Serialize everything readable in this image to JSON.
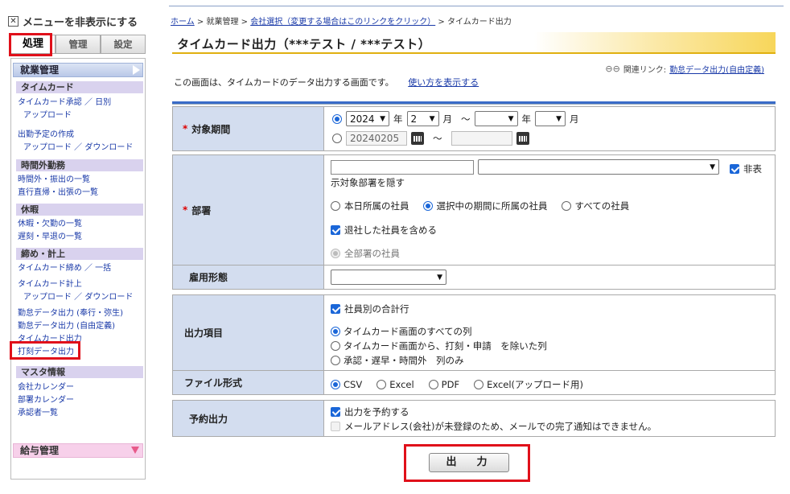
{
  "sidebar": {
    "toggle_label": "メニューを非表示にする",
    "tabs": [
      "処理",
      "管理",
      "設定"
    ],
    "section_header": "就業管理",
    "categories": [
      {
        "title": "タイムカード",
        "items": [
          {
            "label": "タイムカード承認 ／ 日別"
          },
          {
            "label": "アップロード"
          },
          {
            "label": "出勤予定の作成"
          },
          {
            "label": "アップロード ／ ダウンロード"
          }
        ]
      },
      {
        "title": "時間外勤務",
        "items": [
          {
            "label": "時間外・振出の一覧"
          },
          {
            "label": "直行直帰・出張の一覧"
          }
        ]
      },
      {
        "title": "休暇",
        "items": [
          {
            "label": "休暇・欠勤の一覧"
          },
          {
            "label": "遅刻・早退の一覧"
          }
        ]
      },
      {
        "title": "締め・計上",
        "items": [
          {
            "label": "タイムカード締め ／ 一括"
          },
          {
            "label": "タイムカード計上"
          },
          {
            "label": "アップロード ／ ダウンロード"
          },
          {
            "label": "勤怠データ出力 (奉行・弥生)"
          },
          {
            "label": "勤怠データ出力 (自由定義)"
          },
          {
            "label": "タイムカード出力"
          },
          {
            "label": "打刻データ出力"
          }
        ]
      },
      {
        "title": "マスタ情報",
        "items": [
          {
            "label": "会社カレンダー"
          },
          {
            "label": "部署カレンダー"
          },
          {
            "label": "承認者一覧"
          }
        ]
      }
    ],
    "footer_label": "給与管理"
  },
  "breadcrumb": {
    "home": "ホーム",
    "sep": ">",
    "item1": "就業管理",
    "item2": "会社選択（変更する場合はこのリンクをクリック）",
    "current": "タイムカード出力"
  },
  "page": {
    "title": "タイムカード出力（***テスト / ***テスト）",
    "related_label": "関連リンク:",
    "related_link": "勤怠データ出力(自由定義)",
    "description": "この画面は、タイムカードのデータ出力する画面です。",
    "howto_link": "使い方を表示する"
  },
  "form": {
    "period": {
      "label": "対象期間",
      "year_value": "2024",
      "year_suffix": "年",
      "month_value": "2",
      "month_suffix": "月",
      "tilde": "～",
      "end_year_suffix": "年",
      "end_month_suffix": "月",
      "date_from": "20240205",
      "date_tilde": "～"
    },
    "department": {
      "label": "部署",
      "hide_label": "非表",
      "hide_label_cont": "示対象部署を隠す",
      "scope_options": [
        "本日所属の社員",
        "選択中の期間に所属の社員",
        "すべての社員"
      ],
      "include_retired": "退社した社員を含める",
      "all_depts": "全部署の社員"
    },
    "employment": {
      "label": "雇用形態"
    },
    "output_items": {
      "label": "出力項目",
      "subtotal": "社員別の合計行",
      "options": [
        "タイムカード画面のすべての列",
        "タイムカード画面から、打刻・申請　を除いた列",
        "承認・遅早・時間外　列のみ"
      ]
    },
    "file_format": {
      "label": "ファイル形式",
      "options": [
        "CSV",
        "Excel",
        "PDF",
        "Excel(アップロード用)"
      ]
    },
    "reserve": {
      "label": "予約出力",
      "reserve_check": "出力を予約する",
      "mail_note": "メールアドレス(会社)が未登録のため、メールでの完了通知はできません。"
    },
    "submit_label": "出　力"
  },
  "colors": {
    "highlight_red": "#e0101a",
    "label_bg": "#d3ddef",
    "accent_blue": "#3a6cc8"
  }
}
